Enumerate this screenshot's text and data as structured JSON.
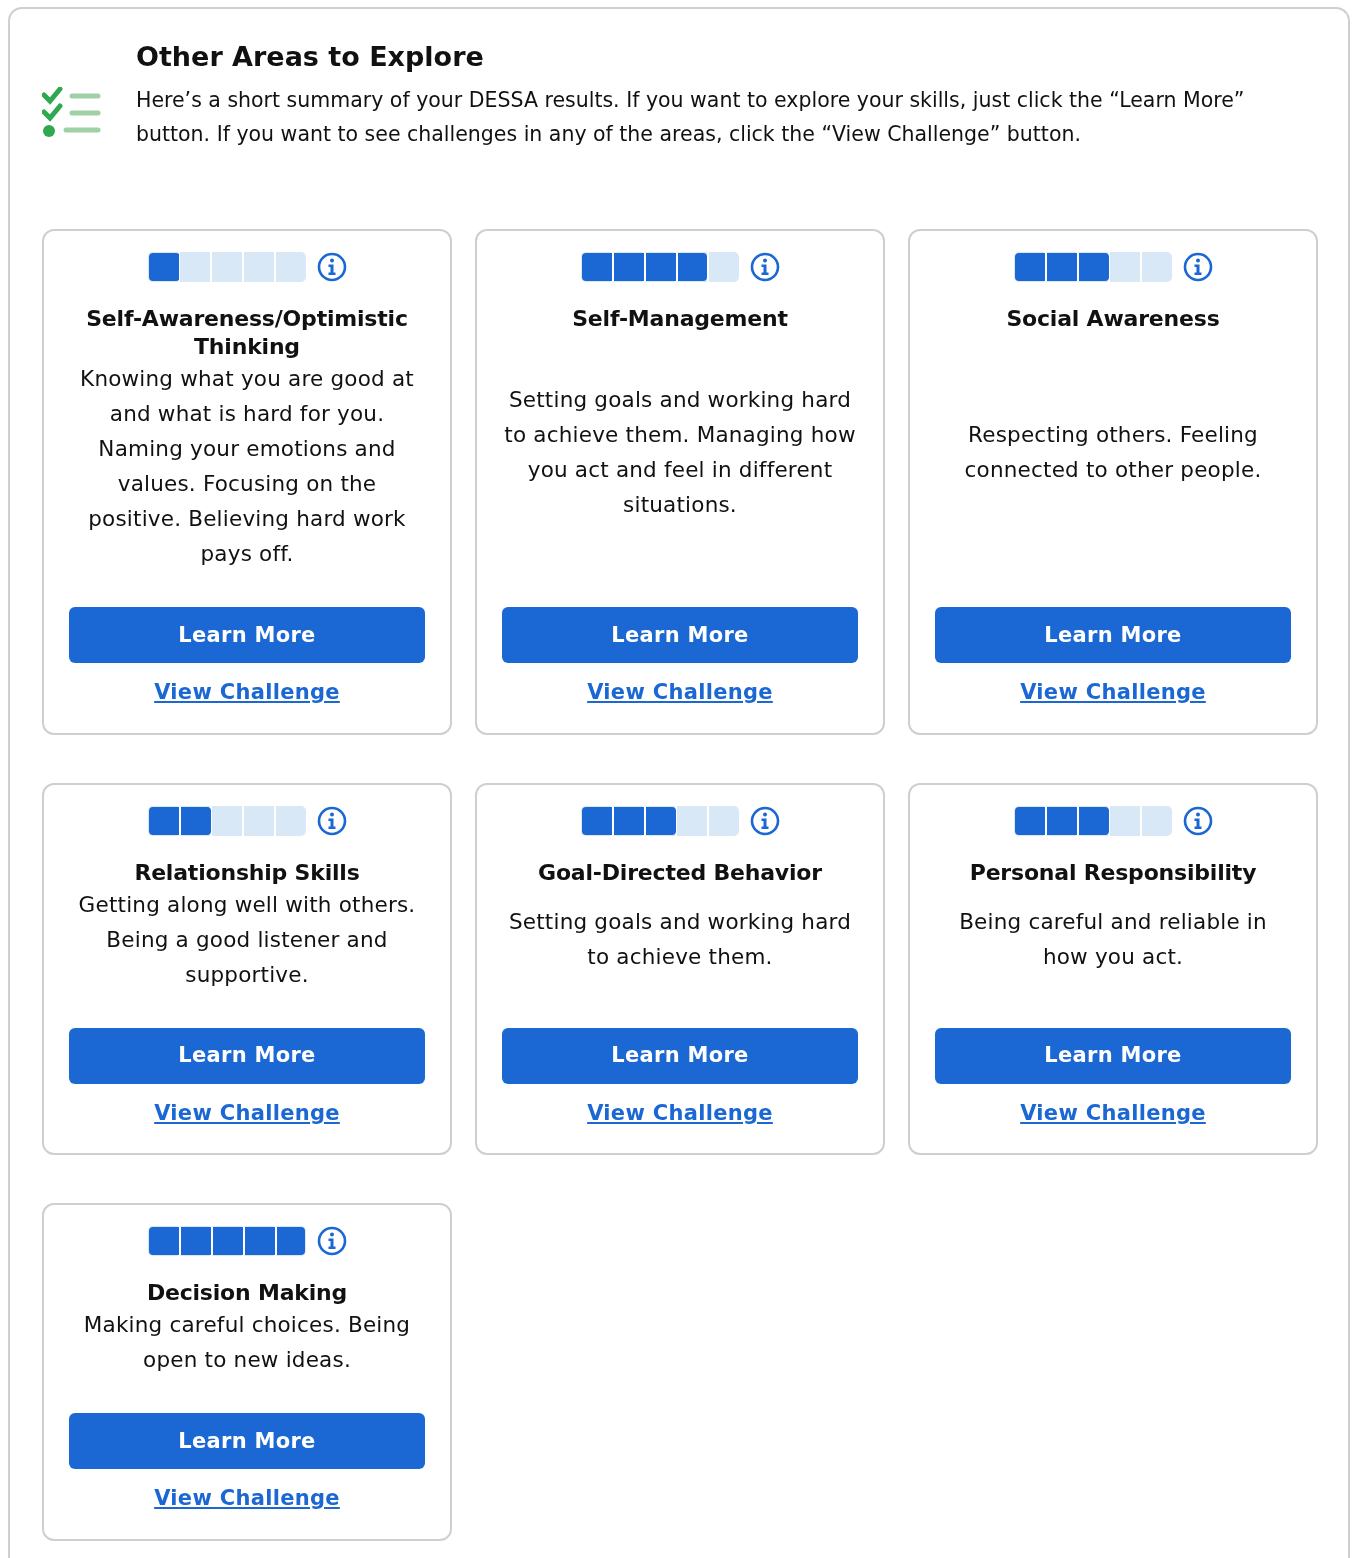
{
  "header": {
    "title": "Other Areas to Explore",
    "description": "Here’s a short summary of your DESSA results. If you want to explore your skills, just click the “Learn More” button. If you want to see challenges in any of the areas, click the “View Challenge” button."
  },
  "areas": [
    {
      "title": "Self-Awareness/Optimistic Thinking",
      "level": 0.2,
      "description": "Knowing what you are good at and what is hard for you. Naming your emotions and values. Focusing on the positive. Believing hard work pays off.",
      "button": "Learn More",
      "link": "View Challenge"
    },
    {
      "title": "Self-Management",
      "level": 0.8,
      "description": "Setting goals and working hard to achieve them. Managing how you act and feel in different situations.",
      "button": "Learn More",
      "link": "View Challenge"
    },
    {
      "title": "Social Awareness",
      "level": 0.6,
      "description": "Respecting others. Feeling connected to other people.",
      "button": "Learn More",
      "link": "View Challenge"
    },
    {
      "title": "Relationship Skills",
      "level": 0.4,
      "description": "Getting along well with others. Being a good listener and supportive.",
      "button": "Learn More",
      "link": "View Challenge"
    },
    {
      "title": "Goal-Directed Behavior",
      "level": 0.6,
      "description": "Setting goals and working hard to achieve them.",
      "button": "Learn More",
      "link": "View Challenge"
    },
    {
      "title": "Personal Responsibility",
      "level": 0.6,
      "description": "Being careful and reliable in how you act.",
      "button": "Learn More",
      "link": "View Challenge"
    },
    {
      "title": "Decision Making",
      "level": 1,
      "description": "Making careful choices. Being open to new ideas.",
      "button": "Learn More",
      "link": "View Challenge"
    }
  ]
}
